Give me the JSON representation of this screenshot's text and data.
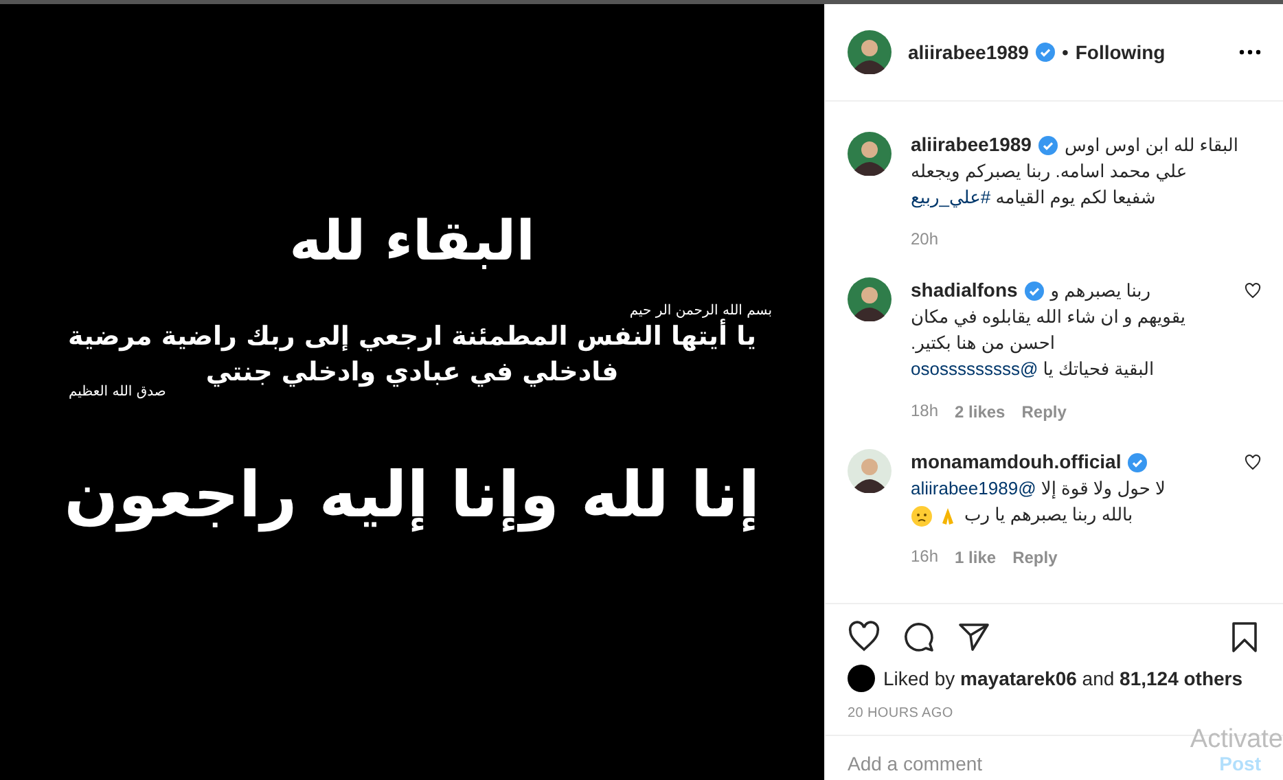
{
  "post_image": {
    "title": "البقاء لله",
    "basmala": "بسم الله الرحمن الر حيم",
    "verse_lines": [
      "يا أيتها النفس المطمئنة ارجعي إلى ربك راضية مرضية",
      "فادخلي في عبادي وادخلي جنتي"
    ],
    "attribution": "صدق الله العظيم",
    "closing": "إنا لله وإنا إليه راجعون"
  },
  "header": {
    "username": "aliirabee1989",
    "verified": true,
    "separator": "•",
    "follow": "Following"
  },
  "caption": {
    "username": "aliirabee1989",
    "verified": true,
    "head_text": "البقاء لله ابن اوس اوس",
    "lines": [
      {
        "text": "علي محمد اسامه. ربنا يصبركم ويجعله"
      },
      {
        "text": "شفيعا لكم يوم القيامه",
        "link": "#علي_ربيع"
      }
    ],
    "time": "20h"
  },
  "comments": [
    {
      "username": "shadialfons",
      "verified": true,
      "liked": false,
      "head_text": "ربنا يصبرهم و",
      "lines": [
        {
          "text": "يقويهم و ان شاء الله يقابلوه في مكان"
        },
        {
          "text": "احسن من هنا بكتير."
        },
        {
          "text": "البقية فحياتك يا",
          "link": "@ososssssssss"
        }
      ],
      "time": "18h",
      "likes": "2 likes",
      "reply": "Reply"
    },
    {
      "username": "monamamdouh.official",
      "verified": true,
      "liked": false,
      "lines": [
        {
          "text": "لا حول ولا قوة إلا",
          "link": "@aliirabee1989"
        },
        {
          "text": "بالله ربنا يصبرهم يا رب",
          "emoji": true
        }
      ],
      "time": "16h",
      "likes": "1 like",
      "reply": "Reply"
    }
  ],
  "likes_line": "Liked by **mayatarek06** and **81,124 others**",
  "timestamp": "20 HOURS AGO",
  "comment_field": {
    "placeholder": "Add a comment"
  },
  "post_button": "Post",
  "system_notice": "Activate"
}
